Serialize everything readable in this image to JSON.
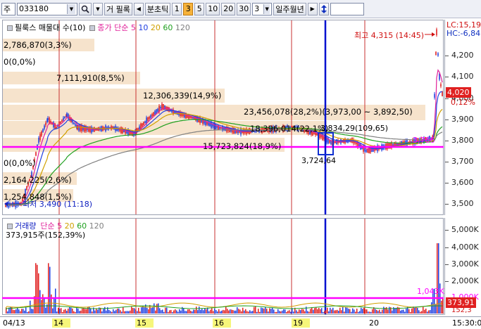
{
  "toolbar": {
    "market": "주",
    "code": "033180",
    "search_icon": "magnifier-icon",
    "trade_label": "거 필록",
    "tick_mode": "분초틱",
    "periods": [
      "1",
      "3",
      "5",
      "10",
      "20",
      "30"
    ],
    "active_period": "3",
    "interval_value": "3",
    "period_types": "일주월년",
    "updown_icon": "up-down-arrow-icon"
  },
  "price_panel": {
    "legend_title": "필룩스 매물대 수(10)",
    "legend_ma_label": "종가 단순",
    "legend_ma": [
      {
        "label": "5",
        "color": "#e0209a"
      },
      {
        "label": "10",
        "color": "#2040e0"
      },
      {
        "label": "20",
        "color": "#d0a000"
      },
      {
        "label": "60",
        "color": "#20a020"
      },
      {
        "label": "120",
        "color": "#808080"
      }
    ],
    "right_top_lc": "LC:15,19",
    "right_top_hc": "HC:-6,84",
    "axis_labels": [
      "4,200",
      "4,100",
      "4,000",
      "3,900",
      "3,800",
      "3,700",
      "3,600",
      "3,500"
    ],
    "current_price": "4,020",
    "current_change": "0,12%",
    "annotations": {
      "high": "최고 4,315 (14:45)",
      "low": "최저 3,490 (11:18)",
      "vp1": "2,786,870(3,3%)",
      "vp2": "0(0,0%)",
      "vp3": "7,111,910(8,5%)",
      "vp4": "12,306,339(14,9%)",
      "vp5": "23,456,078(28,2%)(3,973,00 ~ 3,892,50)",
      "vp6": "18,396,014(22,1%)",
      "vp7": "15,723,824(18,9%)",
      "vp8": "0(0,0%)",
      "vp9": "2,164,225(2,6%)",
      "vp10": "1,254,848(1,5%)",
      "box_top": "3,834,29(109,65)",
      "box_bottom": "3,724,64",
      "magenta_price": "3,766"
    }
  },
  "volume_panel": {
    "legend_title": "거래량",
    "legend_ma_label": "단순",
    "legend_ma": [
      {
        "label": "5",
        "color": "#e0209a"
      },
      {
        "label": "20",
        "color": "#d0a000"
      },
      {
        "label": "60",
        "color": "#20a020"
      },
      {
        "label": "120",
        "color": "#808080"
      }
    ],
    "volume_text": "373,915주(152,39%)",
    "axis_labels": [
      "5,000K",
      "4,000K",
      "3,000K",
      "2,000K",
      "1,000K"
    ],
    "magenta_level": "1,043K",
    "current_volume": "373,91",
    "current_vol_pct": "152,3"
  },
  "x_axis": {
    "labels": [
      {
        "text": "04/13",
        "hl": false
      },
      {
        "text": "14",
        "hl": true
      },
      {
        "text": "15",
        "hl": true
      },
      {
        "text": "16",
        "hl": true
      },
      {
        "text": "19",
        "hl": true
      },
      {
        "text": "20",
        "hl": false
      }
    ],
    "time": "15:30:0"
  },
  "colors": {
    "candle_up": "#e02020",
    "candle_down": "#2040e0",
    "magenta": "#ff00ff",
    "vertical_blue": "#0010d0",
    "band": "#f6e3cc"
  }
}
